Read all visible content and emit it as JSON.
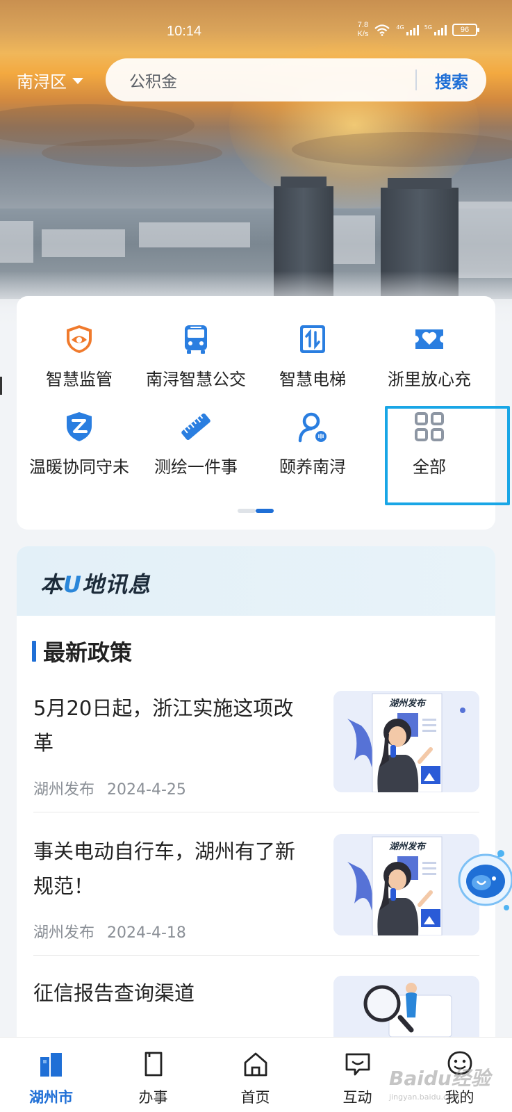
{
  "status_bar": {
    "time": "10:14",
    "net_speed_value": "7.8",
    "net_speed_unit": "K/s",
    "signal1_label": "4G",
    "signal2_label": "5G",
    "battery": "96"
  },
  "header": {
    "district": "南浔区",
    "search_placeholder": "公积金",
    "search_button": "搜索"
  },
  "services": [
    {
      "label": "智慧监管",
      "icon": "shield-eye-icon",
      "color": "#f07a2c"
    },
    {
      "label": "南浔智慧公交",
      "icon": "bus-icon",
      "color": "#2a7ee0"
    },
    {
      "label": "智慧电梯",
      "icon": "elevator-icon",
      "color": "#2a7ee0"
    },
    {
      "label": "浙里放心充",
      "icon": "ticket-heart-icon",
      "color": "#2a7ee0"
    },
    {
      "label": "温暖协同守未",
      "icon": "shield-z-icon",
      "color": "#2a7ee0"
    },
    {
      "label": "测绘一件事",
      "icon": "ruler-icon",
      "color": "#2a7ee0"
    },
    {
      "label": "颐养南浔",
      "icon": "person-care-icon",
      "color": "#2a7ee0"
    },
    {
      "label": "全部",
      "icon": "grid-icon",
      "color": "#8d96a3"
    }
  ],
  "pager": {
    "pages": 2,
    "active_index": 1
  },
  "news": {
    "logo_text_a": "本",
    "logo_text_u": "U",
    "logo_text_b": "地讯息",
    "section_title": "最新政策",
    "thumb_caption": "湖州发布",
    "items": [
      {
        "title": "5月20日起，浙江实施这项改革",
        "source": "湖州发布",
        "date": "2024-4-25"
      },
      {
        "title": "事关电动自行车，湖州有了新规范！",
        "source": "湖州发布",
        "date": "2024-4-18"
      },
      {
        "title": "征信报告查询渠道",
        "source": "",
        "date": ""
      }
    ]
  },
  "tabbar": [
    {
      "label": "湖州市",
      "icon": "city-icon",
      "active": true
    },
    {
      "label": "办事",
      "icon": "document-icon",
      "active": false
    },
    {
      "label": "首页",
      "icon": "home-icon",
      "active": false
    },
    {
      "label": "互动",
      "icon": "chat-icon",
      "active": false
    },
    {
      "label": "我的",
      "icon": "smiley-user-icon",
      "active": false
    }
  ],
  "watermark": {
    "main": "Baidu经验",
    "sub": "jingyan.baidu.com"
  },
  "colors": {
    "accent": "#1f6fd6",
    "highlight_border": "#19a6e6",
    "orange": "#f07a2c"
  }
}
